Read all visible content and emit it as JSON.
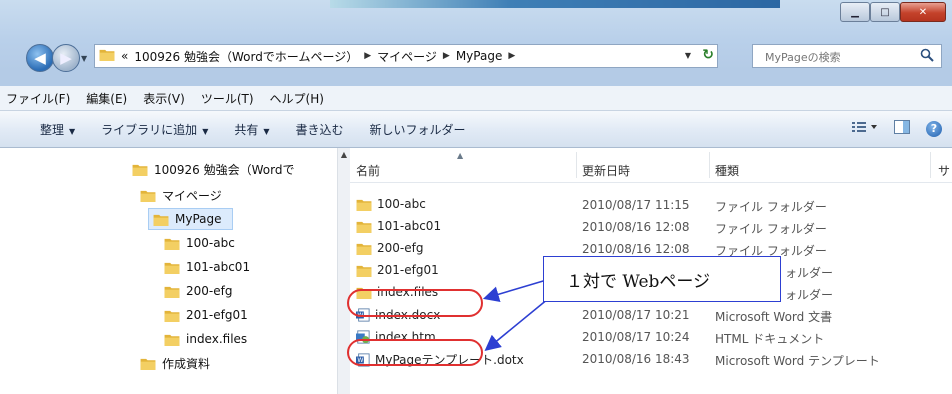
{
  "address": {
    "overflow": "«",
    "crumbs": [
      "100926 勉強会（Wordでホームページ）",
      "マイページ",
      "MyPage"
    ],
    "search_placeholder": "MyPageの検索"
  },
  "menu": [
    "ファイル(F)",
    "編集(E)",
    "表示(V)",
    "ツール(T)",
    "ヘルプ(H)"
  ],
  "toolbar": {
    "organize": "整理",
    "add_to_library": "ライブラリに追加",
    "share": "共有",
    "burn": "書き込む",
    "new_folder": "新しいフォルダー"
  },
  "tree": [
    {
      "label": "100926 勉強会（Wordで"
    },
    {
      "label": "マイページ"
    },
    {
      "label": "MyPage"
    },
    {
      "label": "100-abc"
    },
    {
      "label": "101-abc01"
    },
    {
      "label": "200-efg"
    },
    {
      "label": "201-efg01"
    },
    {
      "label": "index.files"
    },
    {
      "label": "作成資料"
    }
  ],
  "columns": {
    "name": "名前",
    "date": "更新日時",
    "type": "種類",
    "size": "サ"
  },
  "files": [
    {
      "name": "100-abc",
      "date": "2010/08/17 11:15",
      "type": "ファイル フォルダー",
      "icon": "folder-icon"
    },
    {
      "name": "101-abc01",
      "date": "2010/08/16 12:08",
      "type": "ファイル フォルダー",
      "icon": "folder-icon"
    },
    {
      "name": "200-efg",
      "date": "2010/08/16 12:08",
      "type": "ファイル フォルダー",
      "icon": "folder-icon"
    },
    {
      "name": "201-efg01",
      "date": "",
      "type": "ォルダー",
      "icon": "folder-icon"
    },
    {
      "name": "index.files",
      "date": "",
      "type": "ォルダー",
      "icon": "folder-icon"
    },
    {
      "name": "index.docx",
      "date": "2010/08/17 10:21",
      "type": "Microsoft Word 文書",
      "icon": "word-doc-icon"
    },
    {
      "name": "index.htm",
      "date": "2010/08/17 10:24",
      "type": "HTML ドキュメント",
      "icon": "html-doc-icon"
    },
    {
      "name": "MyPageテンプレート.dotx",
      "date": "2010/08/16 18:43",
      "type": "Microsoft Word テンプレート",
      "icon": "word-template-icon"
    }
  ],
  "annotation": {
    "text": "１対で Webページ",
    "color": "#2d3fd2",
    "oval_color": "#e03030"
  },
  "colors": {
    "folder": "#e3b43a",
    "selection": "#dcebfc",
    "frame": "#b9d0ea"
  }
}
